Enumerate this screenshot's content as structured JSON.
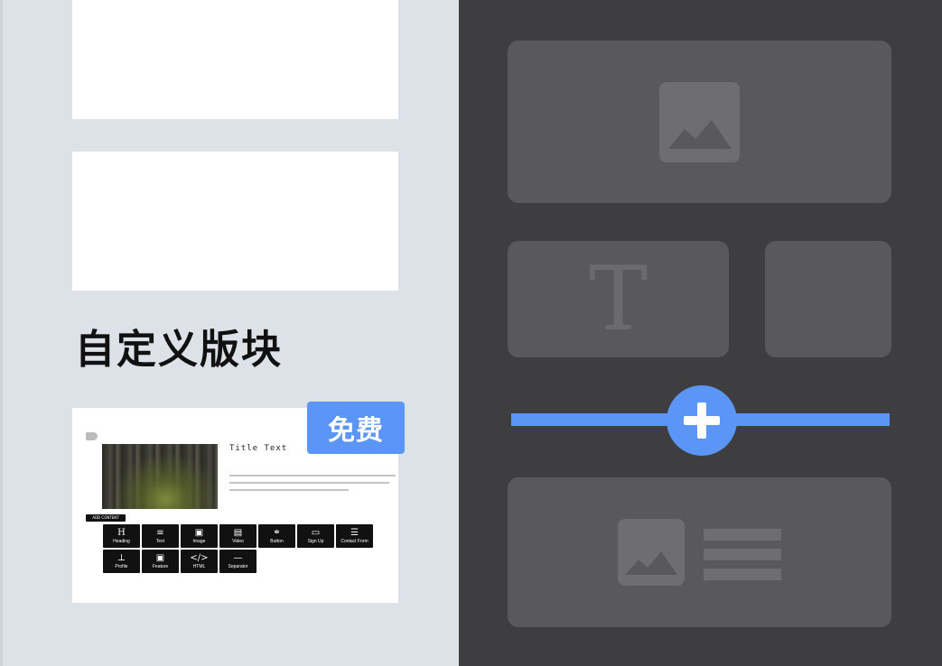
{
  "left": {
    "section_title": "自定义版块",
    "badge": "免费",
    "preview": {
      "title": "Title Text",
      "add_content_label": "ADD CONTENT",
      "tools": [
        {
          "icon": "H",
          "label": "Heading"
        },
        {
          "icon": "≡",
          "label": "Text"
        },
        {
          "icon": "▣",
          "label": "Image"
        },
        {
          "icon": "▤",
          "label": "Video"
        },
        {
          "icon": "⚭",
          "label": "Button"
        },
        {
          "icon": "▭",
          "label": "Sign Up"
        },
        {
          "icon": "☰",
          "label": "Contact Form"
        },
        {
          "icon": "⊥",
          "label": "Profile"
        },
        {
          "icon": "▣",
          "label": "Feature"
        },
        {
          "icon": "</>",
          "label": "HTML"
        },
        {
          "icon": "—",
          "label": "Separator"
        }
      ]
    }
  },
  "right": {
    "text_block_glyph": "T",
    "icons": [
      "image-icon",
      "text-icon",
      "plus-icon",
      "image-icon",
      "text-lines-icon"
    ]
  },
  "colors": {
    "accent": "#5b95f5",
    "left_bg": "#dde2e9",
    "right_bg": "#3e3e40",
    "block": "#59595b"
  }
}
